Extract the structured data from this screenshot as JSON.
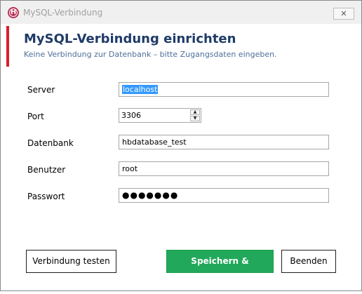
{
  "window": {
    "title": "MySQL-Verbindung",
    "app_icon_letter": "H",
    "close_symbol": "✕"
  },
  "header": {
    "title": "MySQL-Verbindung einrichten",
    "subtitle": "Keine Verbindung zur Datenbank – bitte Zugangsdaten eingeben.",
    "accent_color": "#d91f2b"
  },
  "form": {
    "server": {
      "label": "Server",
      "value": "localhost"
    },
    "port": {
      "label": "Port",
      "value": "3306"
    },
    "database": {
      "label": "Datenbank",
      "value": "hbdatabase_test"
    },
    "user": {
      "label": "Benutzer",
      "value": "root"
    },
    "password": {
      "label": "Passwort",
      "value": "●●●●●●●"
    }
  },
  "buttons": {
    "test": "Verbindung testen",
    "save": "Speichern & Verbinden",
    "quit": "Beenden"
  },
  "colors": {
    "save_button": "#22a85a",
    "title": "#1f3b68"
  }
}
